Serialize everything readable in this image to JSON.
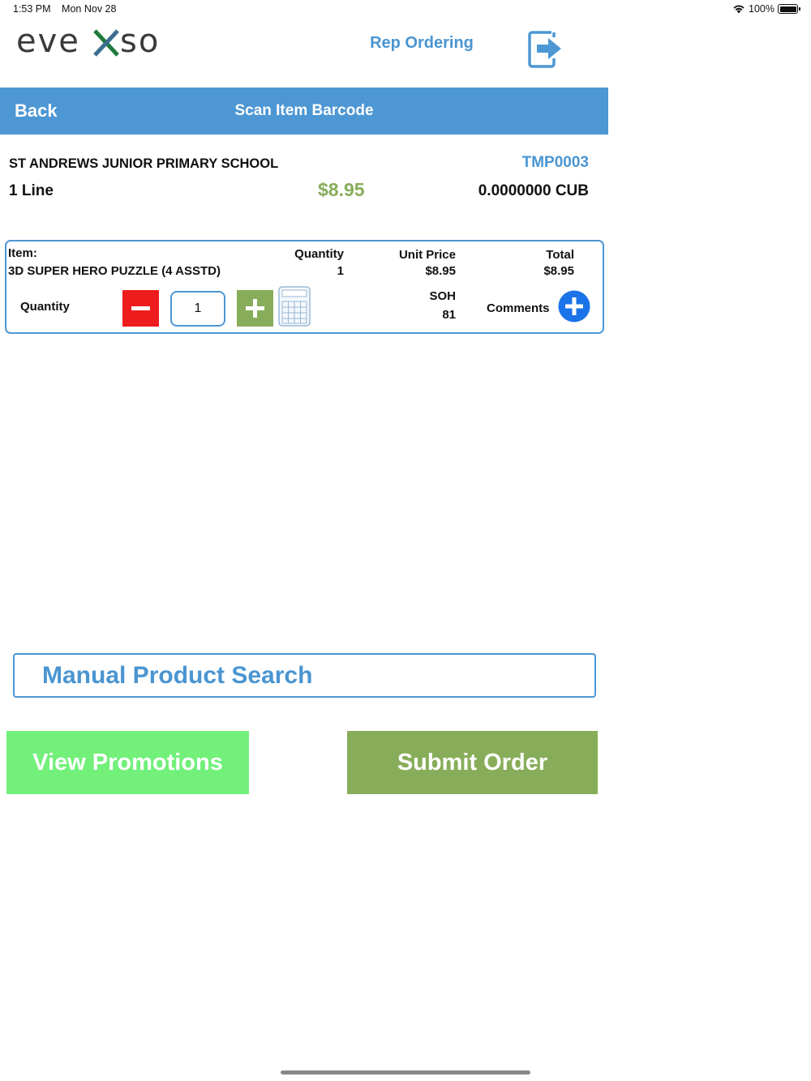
{
  "status_bar": {
    "time": "1:53 PM",
    "date": "Mon Nov 28",
    "battery": "100%",
    "icons": [
      "wifi-icon",
      "battery-icon"
    ]
  },
  "header": {
    "logo_text": "evexso",
    "title": "Rep Ordering",
    "logout_icon": "logout-icon"
  },
  "nav": {
    "back_label": "Back",
    "title": "Scan Item Barcode"
  },
  "order": {
    "customer": "ST ANDREWS JUNIOR PRIMARY SCHOOL",
    "code": "TMP0003",
    "lines": "1 Line",
    "total": "$8.95",
    "cube": "0.0000000 CUB"
  },
  "item": {
    "item_label": "Item:",
    "name": "3D SUPER HERO PUZZLE (4 ASSTD)",
    "quantity_header": "Quantity",
    "quantity": "1",
    "unit_price_header": "Unit Price",
    "unit_price": "$8.95",
    "total_header": "Total",
    "total": "$8.95",
    "soh_header": "SOH",
    "soh": "81",
    "qty_control_label": "Quantity",
    "qty_value": "1",
    "comments_label": "Comments"
  },
  "actions": {
    "manual_search": "Manual Product Search",
    "view_promotions": "View Promotions",
    "submit_order": "Submit Order"
  },
  "colors": {
    "accent_blue": "#4d97d4",
    "green": "#88ad5a",
    "light_green": "#72f07a",
    "red": "#ee1c1c"
  }
}
